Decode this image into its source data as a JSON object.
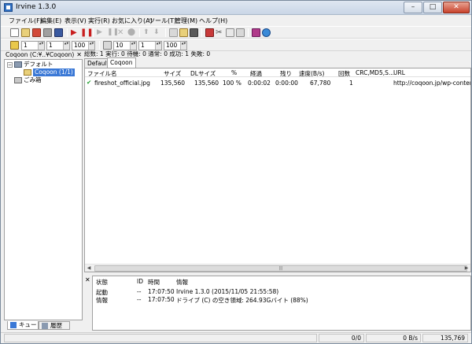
{
  "window": {
    "title": "Irvine 1.3.0"
  },
  "menu": [
    "ファイル(F)",
    "編集(E)",
    "表示(V)",
    "実行(R)",
    "お気に入り(A)",
    "ツール(T)",
    "管理(M)",
    "ヘルプ(H)"
  ],
  "toolbar2": {
    "v1": "1",
    "v2": "1",
    "v3": "100",
    "v4": "10",
    "v5": "1",
    "v6": "100"
  },
  "left": {
    "header": "Coqoon (C:¥..¥Coqoon)",
    "tree": {
      "default": "デフォルト",
      "coqoon": "Coqoon (1/1)",
      "trash": "ごみ箱"
    },
    "tabs": {
      "queue": "キュー",
      "history": "履歴"
    }
  },
  "status": {
    "total_label": "総数:",
    "total": "1",
    "running_label": "実行:",
    "running": "0",
    "waiting_label": "待機:",
    "waiting": "0",
    "normal_label": "通常:",
    "normal": "0",
    "success_label": "成功:",
    "success": "1",
    "fail_label": "失敗:",
    "fail": "0"
  },
  "tabs": [
    "Default",
    "Coqoon"
  ],
  "columns": {
    "filename": "ファイル名",
    "size": "サイズ",
    "dlsize": "DLサイズ",
    "pct": "%",
    "elapsed": "経過",
    "remain": "残り",
    "speed": "速度(B/s)",
    "count": "回数",
    "crc": "CRC,MD5,S...",
    "url": "URL"
  },
  "rows": [
    {
      "filename": "fireshot_official.jpg",
      "size": "135,560",
      "dlsize": "135,560",
      "pct": "100 %",
      "elapsed": "0:00:02",
      "remain": "0:00:00",
      "speed": "67,780",
      "count": "1",
      "crc": "",
      "url": "http://coqoon.jp/wp-content/up"
    }
  ],
  "log": {
    "headers": {
      "state": "状態",
      "id": "ID",
      "time": "時間",
      "info": "情報"
    },
    "rows": [
      {
        "state": "起動",
        "id": "--",
        "time": "17:07:50",
        "info": "Irvine 1.3.0 (2015/11/05 21:55:58)"
      },
      {
        "state": "情報",
        "id": "--",
        "time": "17:07:50",
        "info": "ドライブ (C) の空き領域: 264.93Gバイト (88%)"
      }
    ]
  },
  "statusbar": {
    "count": "0/0",
    "speed": "0 B/s",
    "bytes": "135,769"
  }
}
